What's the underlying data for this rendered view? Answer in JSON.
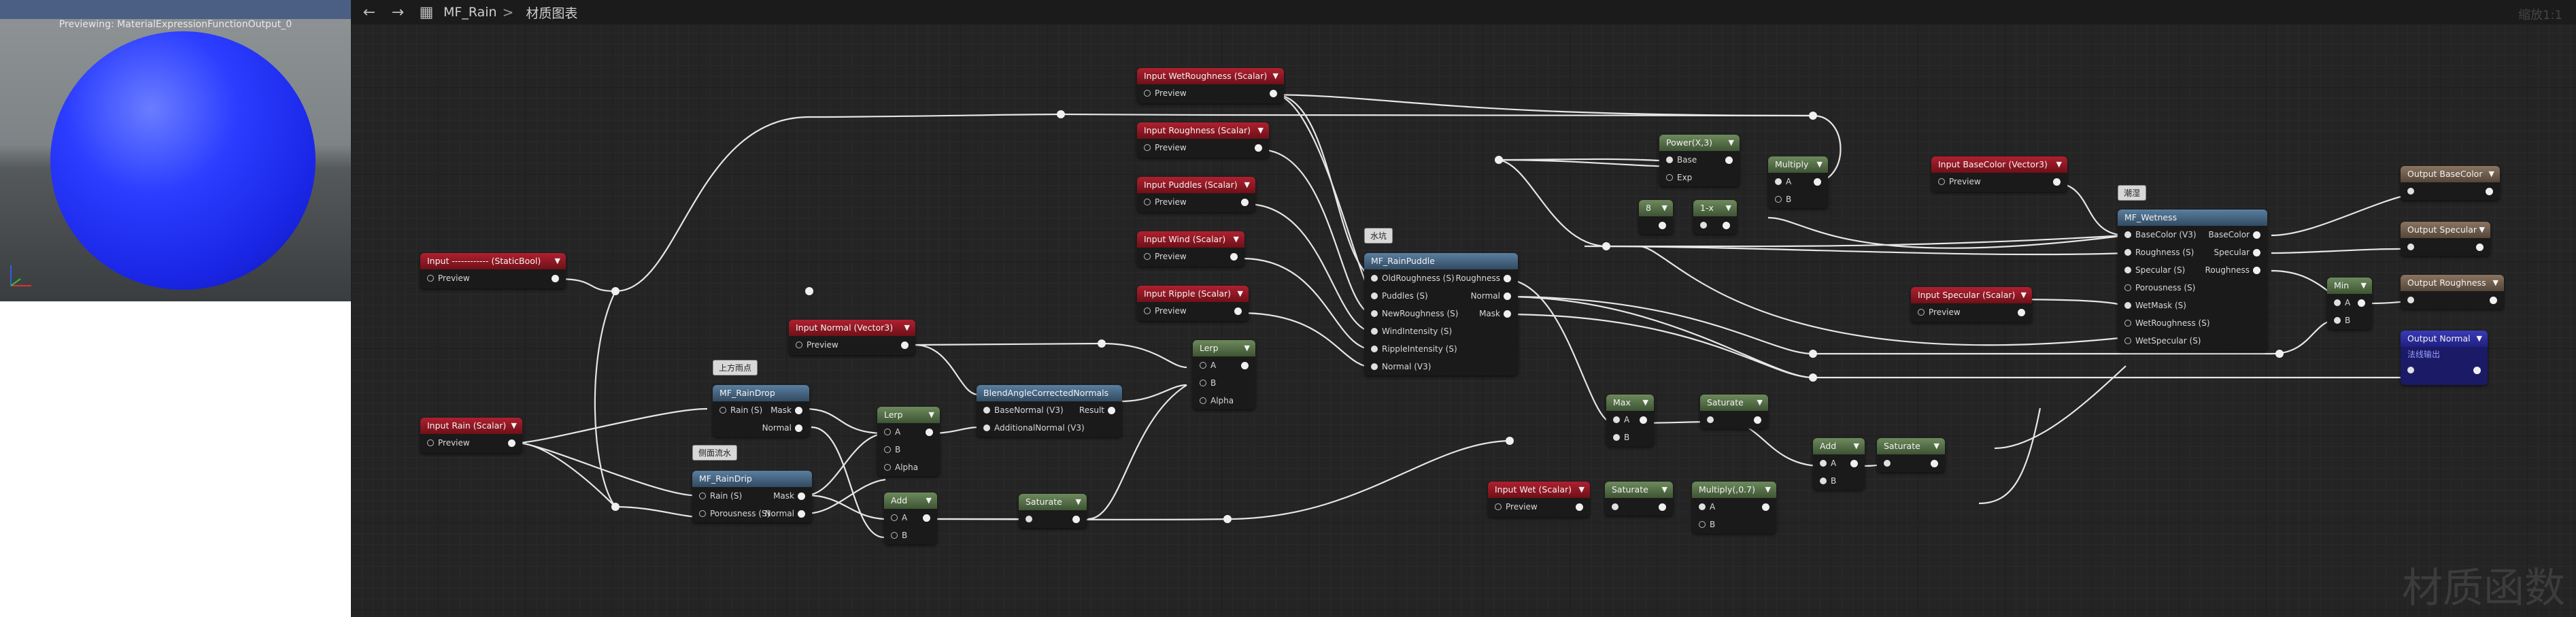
{
  "topbar": {
    "breadcrumb_root": "MF_Rain",
    "breadcrumb_sep": ">",
    "breadcrumb_page": "材质图表",
    "right_label": "缩放1:1"
  },
  "preview": {
    "label": "Previewing: MaterialExpressionFunctionOutput_0"
  },
  "watermark": "材质函数",
  "nodes": {
    "input_static": {
      "title": "Input ------------ (StaticBool)",
      "preview": "Preview"
    },
    "input_rain": {
      "title": "Input Rain (Scalar)",
      "preview": "Preview"
    },
    "input_normal": {
      "title": "Input Normal (Vector3)",
      "preview": "Preview"
    },
    "input_wetrough": {
      "title": "Input WetRoughness (Scalar)",
      "preview": "Preview"
    },
    "input_rough": {
      "title": "Input Roughness (Scalar)",
      "preview": "Preview"
    },
    "input_puddles": {
      "title": "Input Puddles (Scalar)",
      "preview": "Preview"
    },
    "input_wind": {
      "title": "Input Wind (Scalar)",
      "preview": "Preview"
    },
    "input_ripple": {
      "title": "Input Ripple (Scalar)",
      "preview": "Preview"
    },
    "input_basecolor": {
      "title": "Input BaseColor (Vector3)",
      "preview": "Preview"
    },
    "input_specular": {
      "title": "Input Specular (Scalar)",
      "preview": "Preview"
    },
    "input_wet": {
      "title": "Input Wet (Scalar)",
      "preview": "Preview"
    },
    "raindrop": {
      "title": "MF_RainDrop",
      "in1": "Rain (S)",
      "out1": "Mask",
      "out2": "Normal"
    },
    "raindrip": {
      "title": "MF_RainDrip",
      "in1": "Rain (S)",
      "in2": "Porousness (S)",
      "out1": "Mask",
      "out2": "Normal"
    },
    "lerp1": {
      "title": "Lerp",
      "a": "A",
      "b": "B",
      "alpha": "Alpha"
    },
    "lerp2": {
      "title": "Lerp",
      "a": "A",
      "b": "B",
      "alpha": "Alpha"
    },
    "add1": {
      "title": "Add",
      "a": "A",
      "b": "B"
    },
    "saturate1": {
      "title": "Saturate"
    },
    "blend": {
      "title": "BlendAngleCorrectedNormals",
      "in1": "BaseNormal (V3)",
      "in2": "AdditionalNormal (V3)",
      "out1": "Result"
    },
    "puddle": {
      "title": "MF_RainPuddle",
      "in1": "OldRoughness (S)",
      "in2": "Puddles (S)",
      "in3": "NewRoughness (S)",
      "in4": "WindIntensity (S)",
      "in5": "RippleIntensity (S)",
      "in6": "Normal (V3)",
      "out1": "Roughness",
      "out2": "Normal",
      "out3": "Mask"
    },
    "power": {
      "title": "Power(X,3)",
      "in1": "Base",
      "in2": "Exp"
    },
    "multiply1": {
      "title": "Multiply",
      "a": "A",
      "b": "B"
    },
    "const8": {
      "title": "8"
    },
    "const1": {
      "title": "1-x"
    },
    "max": {
      "title": "Max",
      "a": "A",
      "b": "B"
    },
    "saturate2": {
      "title": "Saturate"
    },
    "saturate3": {
      "title": "Saturate"
    },
    "saturate4": {
      "title": "Saturate"
    },
    "multiply2": {
      "title": "Multiply(,0.7)",
      "a": "A",
      "b": "B"
    },
    "add2": {
      "title": "Add",
      "a": "A",
      "b": "B"
    },
    "wetness": {
      "title": "MF_Wetness",
      "in1": "BaseColor (V3)",
      "in2": "Roughness (S)",
      "in3": "Specular (S)",
      "in4": "Porousness (S)",
      "in5": "WetMask (S)",
      "in6": "WetRoughness (S)",
      "in7": "WetSpecular (S)",
      "out1": "BaseColor",
      "out2": "Specular",
      "out3": "Roughness"
    },
    "min": {
      "title": "Min",
      "a": "A",
      "b": "B"
    },
    "out_basecolor": {
      "title": "Output BaseColor"
    },
    "out_specular": {
      "title": "Output Specular"
    },
    "out_roughness": {
      "title": "Output Roughness"
    },
    "out_normal": {
      "title": "Output Normal",
      "sub": "法线输出"
    }
  },
  "comments": {
    "c1": "上方雨点",
    "c2": "侧面流水",
    "c3": "水坑",
    "c4": "潮湿"
  }
}
